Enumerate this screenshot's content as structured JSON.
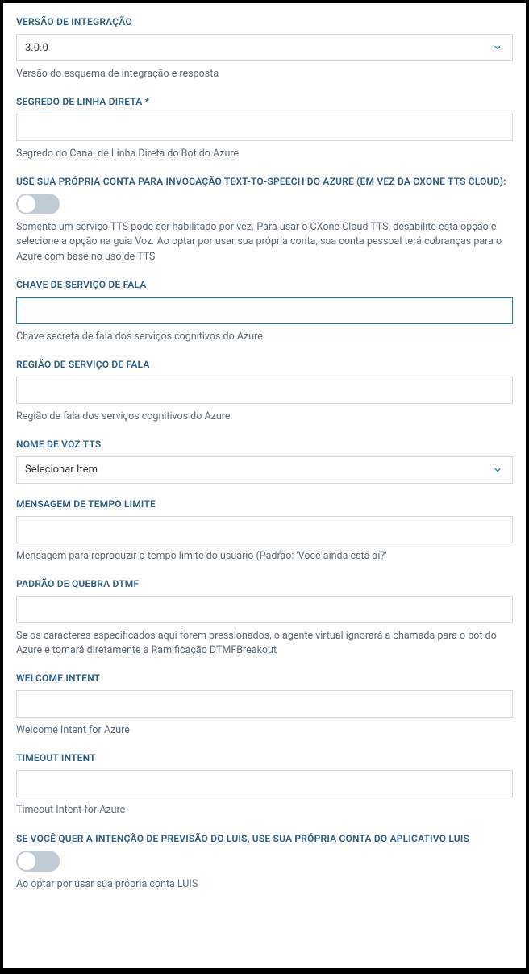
{
  "fields": {
    "integration_version": {
      "label": "VERSÃO DE INTEGRAÇÃO",
      "value": "3.0.0",
      "help": "Versão do esquema de integração e resposta"
    },
    "direct_line_secret": {
      "label": "SEGREDO DE LINHA DIRETA *",
      "value": "",
      "help": "Segredo do Canal de Linha Direta do Bot do Azure"
    },
    "own_tts_account": {
      "label": "USE SUA PRÓPRIA CONTA PARA INVOCAÇÃO TEXT-TO-SPEECH DO AZURE (EM VEZ DA CXONE TTS CLOUD):",
      "value": false,
      "help": "Somente um serviço TTS pode ser habilitado por vez. Para usar o CXone Cloud TTS, desabilite esta opção e selecione a opção na guia Voz. Ao optar por usar sua própria conta, sua conta pessoal terá cobranças para o Azure com base no uso de TTS"
    },
    "speech_service_key": {
      "label": "CHAVE DE SERVIÇO DE FALA",
      "value": "",
      "help": "Chave secreta de fala dos serviços cognitivos do Azure"
    },
    "speech_service_region": {
      "label": "REGIÃO DE SERVIÇO DE FALA",
      "value": "",
      "help": "Região de fala dos serviços cognitivos do Azure"
    },
    "tts_voice_name": {
      "label": "NOME DE VOZ TTS",
      "value": "Selecionar Item",
      "help": ""
    },
    "timeout_message": {
      "label": "MENSAGEM DE TEMPO LIMITE",
      "value": "",
      "help": "Mensagem para reproduzir o tempo limite do usuário (Padrão: 'Você ainda está aí?'"
    },
    "dtmf_break_pattern": {
      "label": "PADRÃO DE QUEBRA DTMF",
      "value": "",
      "help": "Se os caracteres especificados aqui forem pressionados, o agente virtual ignorará a chamada para o bot do Azure e tomará diretamente a Ramificação DTMFBreakout"
    },
    "welcome_intent": {
      "label": "WELCOME INTENT",
      "value": "",
      "help": "Welcome Intent for Azure"
    },
    "timeout_intent": {
      "label": "TIMEOUT INTENT",
      "value": "",
      "help": "Timeout Intent for Azure"
    },
    "luis_own_account": {
      "label": "SE VOCÊ QUER A INTENÇÃO DE PREVISÃO DO LUIS, USE SUA PRÓPRIA CONTA DO APLICATIVO LUIS",
      "value": false,
      "help": "Ao optar por usar sua própria conta LUIS"
    }
  }
}
